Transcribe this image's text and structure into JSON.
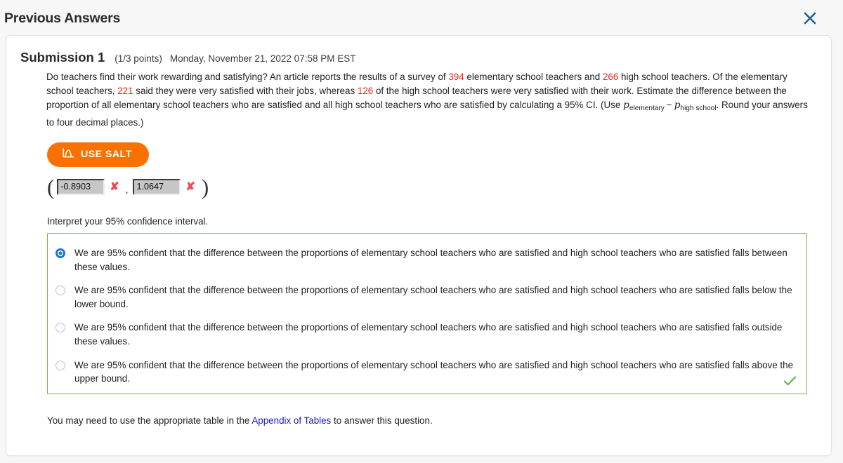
{
  "header": {
    "title": "Previous Answers",
    "close_icon": "close-icon"
  },
  "submission": {
    "title": "Submission 1",
    "points": "(1/3 points)",
    "date": "Monday, November 21, 2022 07:58 PM EST"
  },
  "question": {
    "part1": "Do teachers find their work rewarding and satisfying? An article reports the results of a survey of ",
    "n_elementary": "394",
    "part2": " elementary school teachers and ",
    "n_highschool": "266",
    "part3": " high school teachers. Of the elementary school teachers, ",
    "n_elem_satisfied": "221",
    "part4": " said they were very satisfied with their jobs, whereas ",
    "n_high_satisfied": "126",
    "part5": " of the high school teachers were very satisfied with their work. Estimate the difference between the proportion of all elementary school teachers who are satisfied and all high school teachers who are satisfied by calculating a 95% CI. (Use ",
    "formula_p1": "p",
    "formula_sub1": "elementary",
    "formula_minus": "−",
    "formula_p2": "p",
    "formula_sub2": "high school",
    "part6": ". Round your answers to four decimal places.)"
  },
  "salt_button": {
    "label": "USE SALT",
    "icon": "bell-curve-icon",
    "color": "#f97201"
  },
  "answer": {
    "left_paren": "(",
    "lower_value": "-0.8903",
    "lower_mark": "✘",
    "separator": ",",
    "upper_value": "1.0647",
    "upper_mark": "✘",
    "right_paren": ")",
    "mark_color": "#f0474a"
  },
  "interpret": {
    "label": "Interpret your 95% confidence interval.",
    "box_border_color": "#7cb342",
    "correct_icon": "check-icon",
    "correct_icon_color": "#7cb342",
    "options": [
      {
        "id": "option-between",
        "selected": true,
        "text": "We are 95% confident that the difference between the proportions of elementary school teachers who are satisfied and high school teachers who are satisfied falls between these values."
      },
      {
        "id": "option-below-lower",
        "selected": false,
        "text": "We are 95% confident that the difference between the proportions of elementary school teachers who are satisfied and high school teachers who are satisfied falls below the lower bound."
      },
      {
        "id": "option-outside",
        "selected": false,
        "text": "We are 95% confident that the difference between the proportions of elementary school teachers who are satisfied and high school teachers who are satisfied falls outside these values."
      },
      {
        "id": "option-above-upper",
        "selected": false,
        "text": "We are 95% confident that the difference between the proportions of elementary school teachers who are satisfied and high school teachers who are satisfied falls above the upper bound."
      }
    ]
  },
  "footer": {
    "before_link": "You may need to use the appropriate table in the ",
    "link_text": "Appendix of Tables",
    "after_link": " to answer this question.",
    "link_color": "#1818cf"
  }
}
